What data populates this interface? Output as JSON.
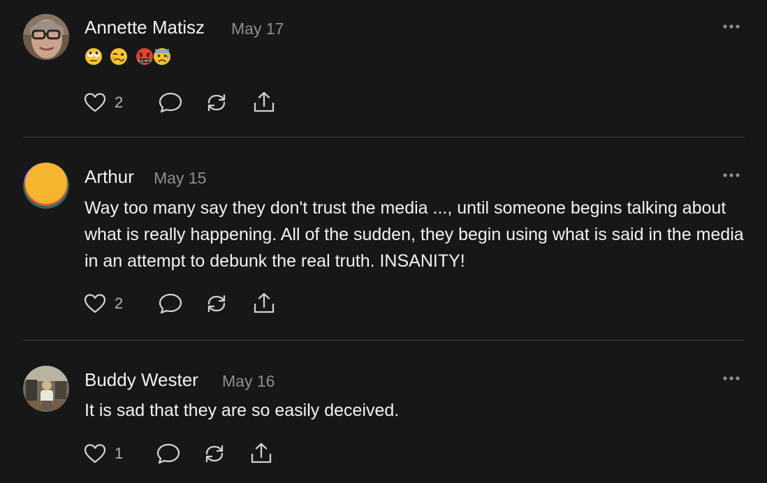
{
  "comments": [
    {
      "author": "Annette Matisz",
      "date": "May 17",
      "text": "",
      "emojis": [
        "face-with-rolling-eyes",
        "woozy-face",
        "face-with-symbols-on-mouth",
        "anxious-face-with-sweat"
      ],
      "likes": "2"
    },
    {
      "author": "Arthur",
      "date": "May 15",
      "text": "Way too many say they don't trust the media ..., until someone begins talking about what is really happening. All of the sudden, they begin using what is said in the media in an attempt to debunk the real truth. INSANITY!",
      "likes": "2"
    },
    {
      "author": "Buddy Wester",
      "date": "May 16",
      "text": "It is sad that they are so easily deceived.",
      "likes": "1"
    }
  ],
  "icons": {
    "like": "heart-outline-icon",
    "reply": "speech-bubble-icon",
    "repost": "repost-arrows-icon",
    "share": "share-upload-icon",
    "more": "more-ellipsis-icon"
  },
  "colors": {
    "background": "#171718",
    "primary_text": "#f2f2f2",
    "secondary_text": "#8e8e93",
    "icon": "#d1d1d6",
    "divider": "#3a3a3c"
  }
}
